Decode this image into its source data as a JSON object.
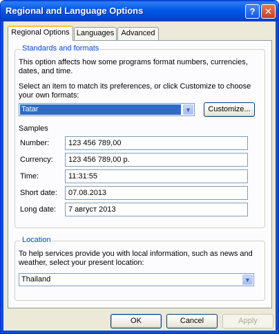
{
  "window": {
    "title": "Regional and Language Options",
    "help_label": "?",
    "close_label": "✕"
  },
  "tabs": [
    {
      "label": "Regional Options",
      "active": true
    },
    {
      "label": "Languages",
      "active": false
    },
    {
      "label": "Advanced",
      "active": false
    }
  ],
  "standards": {
    "title": "Standards and formats",
    "description_line1": "This option affects how some programs format numbers, currencies,",
    "description_line2": "dates, and time.",
    "select_line1": "Select an item to match its preferences, or click Customize to choose",
    "select_line2": "your own formats:",
    "selected_format": "Tatar",
    "customize_label": "Customize...",
    "samples_label": "Samples",
    "samples": [
      {
        "label": "Number:",
        "value": "123 456 789,00"
      },
      {
        "label": "Currency:",
        "value": "123 456 789,00 р."
      },
      {
        "label": "Time:",
        "value": "11:31:55"
      },
      {
        "label": "Short date:",
        "value": "07.08.2013"
      },
      {
        "label": "Long date:",
        "value": "7 август 2013"
      }
    ]
  },
  "location": {
    "title": "Location",
    "description_line1": "To help services provide you with local information, such as news and",
    "description_line2": "weather, select your present location:",
    "selected_location": "Thailand"
  },
  "footer": {
    "ok_label": "OK",
    "cancel_label": "Cancel",
    "apply_label": "Apply",
    "apply_enabled": false
  },
  "icons": {
    "dropdown": "chevron-down-icon"
  },
  "colors": {
    "title_bar": "#0058e6",
    "group_title": "#0046d5",
    "selection": "#316ac5",
    "dialog_bg": "#ece9d8"
  }
}
